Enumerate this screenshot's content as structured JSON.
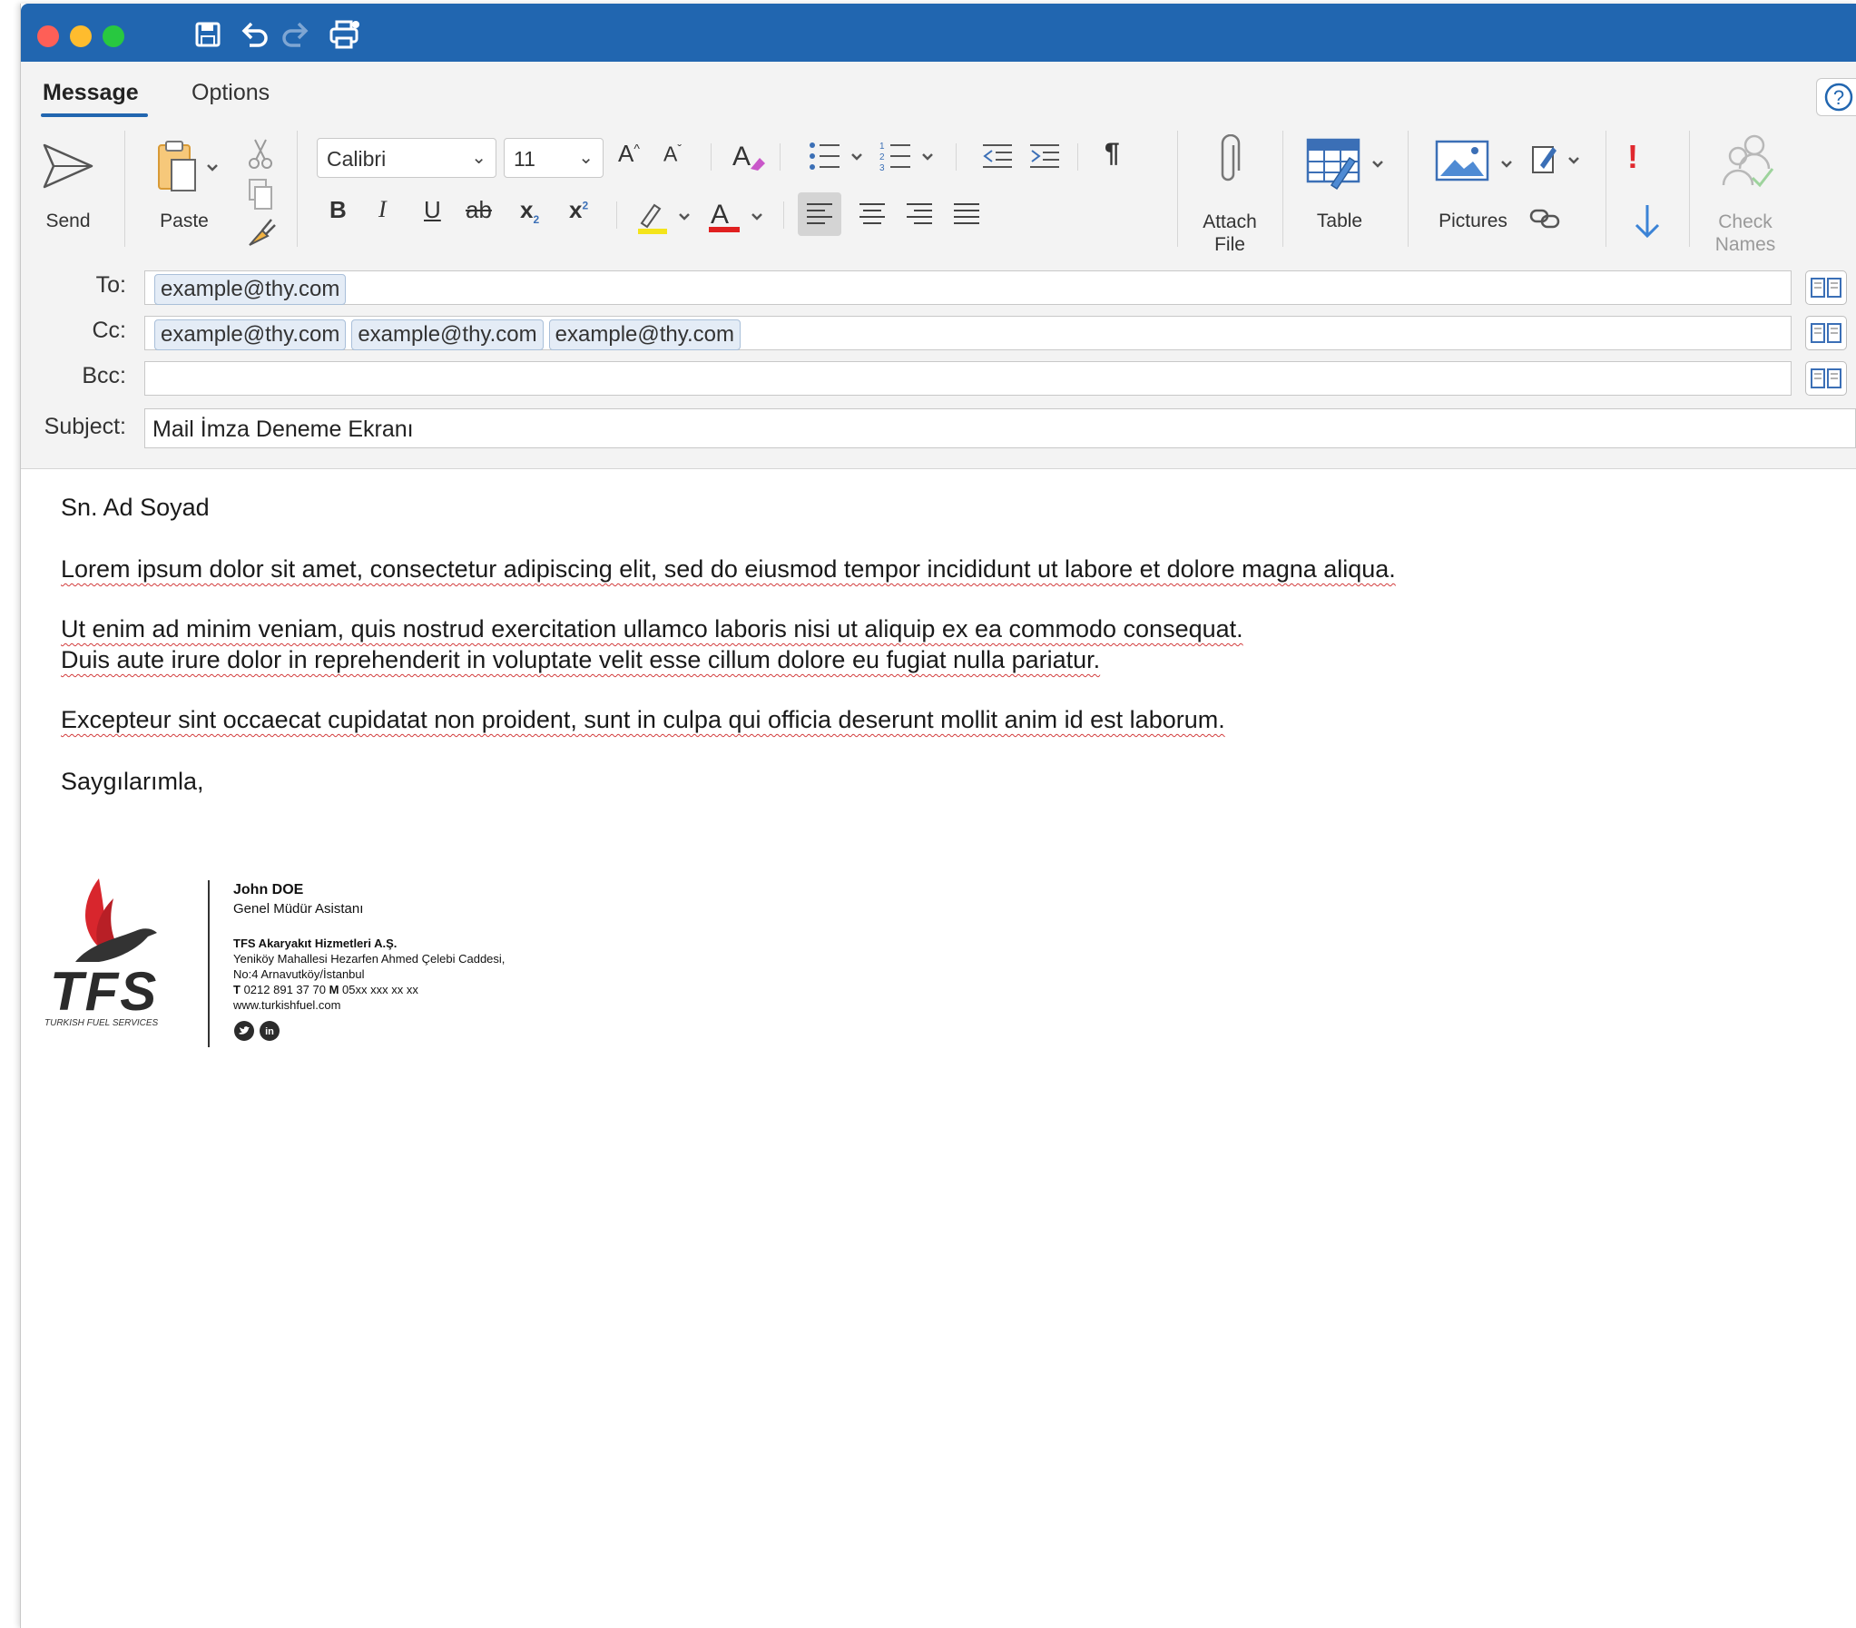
{
  "ribbon_tabs": {
    "message": "Message",
    "options": "Options"
  },
  "ribbon": {
    "send": "Send",
    "paste": "Paste",
    "font_name": "Calibri",
    "font_size": "11",
    "attach_line1": "Attach",
    "attach_line2": "File",
    "table": "Table",
    "pictures": "Pictures",
    "check_line1": "Check",
    "check_line2": "Names",
    "format_labels": {
      "bold": "B",
      "italic": "I",
      "underline": "U",
      "strike": "ab",
      "subscript": "x",
      "superscript": "x",
      "grow": "A",
      "shrink": "A",
      "pilcrow": "¶",
      "importance_high": "!"
    }
  },
  "header": {
    "to_label": "To:",
    "cc_label": "Cc:",
    "bcc_label": "Bcc:",
    "subject_label": "Subject:",
    "to": [
      "example@thy.com"
    ],
    "cc": [
      "example@thy.com",
      "example@thy.com",
      "example@thy.com"
    ],
    "subject": "Mail İmza Deneme Ekranı"
  },
  "body": {
    "greeting": "Sn. Ad Soyad",
    "p1": "Lorem ipsum dolor sit amet, consectetur adipiscing elit, sed do eiusmod tempor incididunt ut labore et dolore magna aliqua.",
    "p2a": "Ut enim ad minim veniam, quis nostrud exercitation ullamco laboris nisi ut aliquip ex ea commodo consequat.",
    "p2b": "Duis aute irure dolor in reprehenderit in voluptate velit esse cillum dolore eu fugiat nulla pariatur.",
    "p3": "Excepteur sint occaecat cupidatat non proident, sunt in culpa qui officia deserunt mollit anim id est laborum.",
    "closing": "Saygılarımla,"
  },
  "signature": {
    "logo_text": "TFS",
    "logo_tagline": "TURKISH FUEL SERVICES",
    "name": "John DOE",
    "title": "Genel Müdür Asistanı",
    "company": "TFS Akaryakıt Hizmetleri A.Ş.",
    "address1": "Yeniköy Mahallesi Hezarfen Ahmed Çelebi Caddesi,",
    "address2": "No:4 Arnavutköy/İstanbul",
    "phone_label": "T",
    "phone": "0212 891 37 70",
    "mobile_label": "M",
    "mobile": "05xx xxx xx xx",
    "web": "www.turkishfuel.com"
  },
  "colors": {
    "titlebar": "#2166b0",
    "accent": "#2166b0",
    "logo_red": "#d8262d",
    "spell_underline": "#d23c3c"
  }
}
